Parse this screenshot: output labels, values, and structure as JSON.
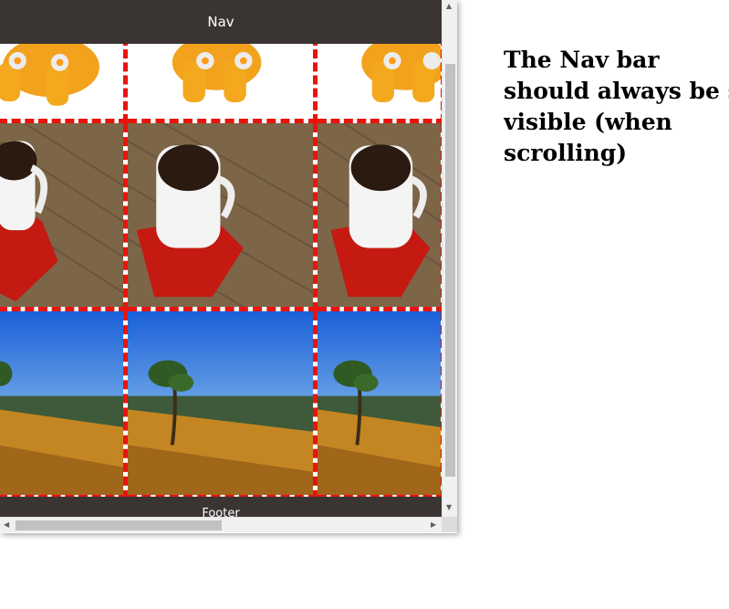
{
  "nav": {
    "label": "Nav"
  },
  "footer": {
    "label": "Footer"
  },
  "note": {
    "lines": [
      "The Nav bar",
      "should always be s",
      "visible (when",
      "scrolling)"
    ]
  },
  "gallery": {
    "rows": [
      [
        "toy-image",
        "toy-image",
        "toy-image"
      ],
      [
        "coffee-cup-image",
        "coffee-cup-image",
        "coffee-cup-image"
      ],
      [
        "tree-landscape-image",
        "tree-landscape-image",
        "tree-landscape-image"
      ]
    ]
  },
  "colors": {
    "nav_bg": "#3a3532",
    "dashed_border": "#e8140e",
    "scrollbar_thumb": "#c1c1c1"
  }
}
